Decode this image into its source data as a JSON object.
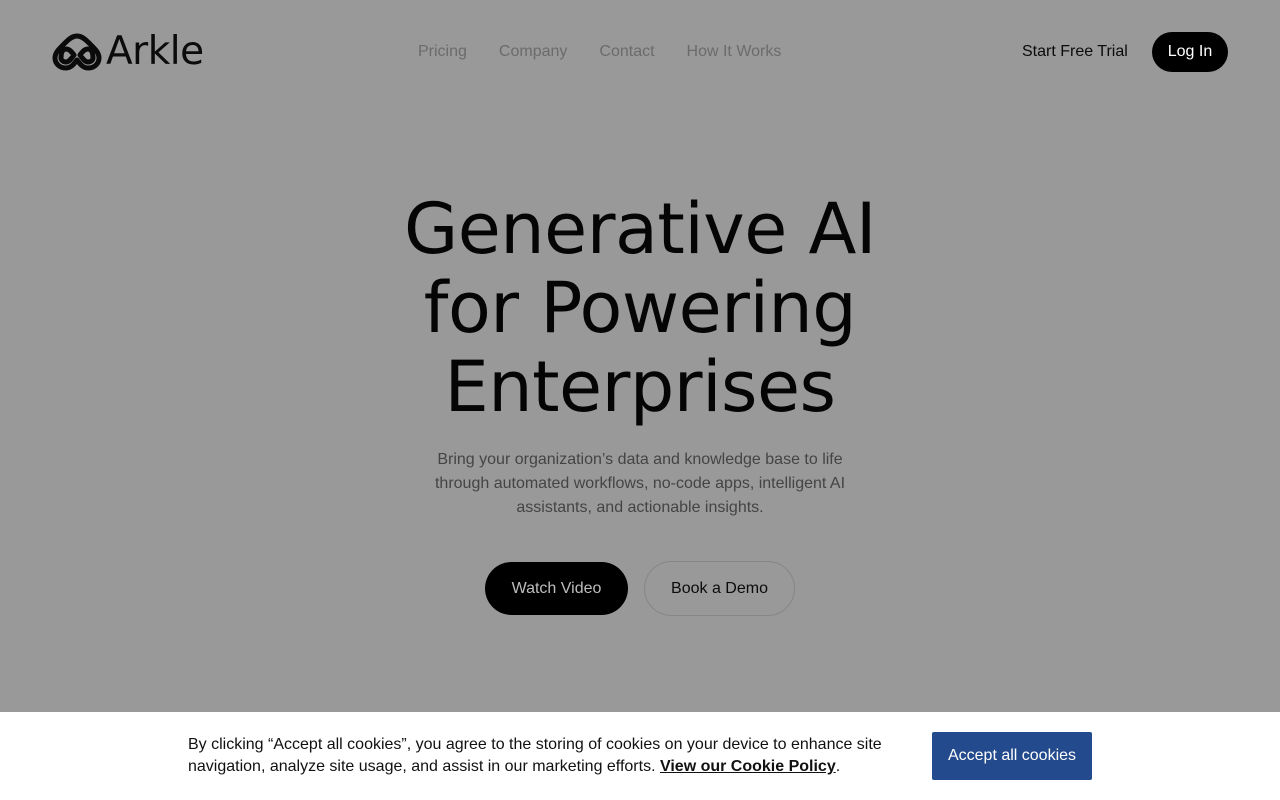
{
  "brand": {
    "name": "Arkle",
    "logo_icon": "infinity-mark-icon"
  },
  "nav": {
    "items": [
      {
        "label": "Pricing"
      },
      {
        "label": "Company"
      },
      {
        "label": "Contact"
      },
      {
        "label": "How It Works"
      }
    ]
  },
  "header": {
    "trial_label": "Start Free Trial",
    "login_label": "Log In"
  },
  "hero": {
    "title_lines": [
      "Generative AI",
      "for Powering",
      "Enterprises"
    ],
    "subtitle": "Bring your organization’s data and knowledge base to life through automated workflows, no-code apps, intelligent AI assistants, and actionable insights.",
    "watch_label": "Watch Video",
    "demo_label": "Book a Demo"
  },
  "cookie": {
    "text": "By clicking “Accept all cookies”, you agree to the storing of cookies on your device to enhance site navigation, analyze site usage, and assist in our marketing efforts. ",
    "policy_link": "View our Cookie Policy",
    "trailing": ".",
    "accept_label": "Accept all cookies"
  },
  "colors": {
    "overlay_background": "#999999",
    "accept_button": "#234a8c",
    "primary_button": "#000000"
  }
}
